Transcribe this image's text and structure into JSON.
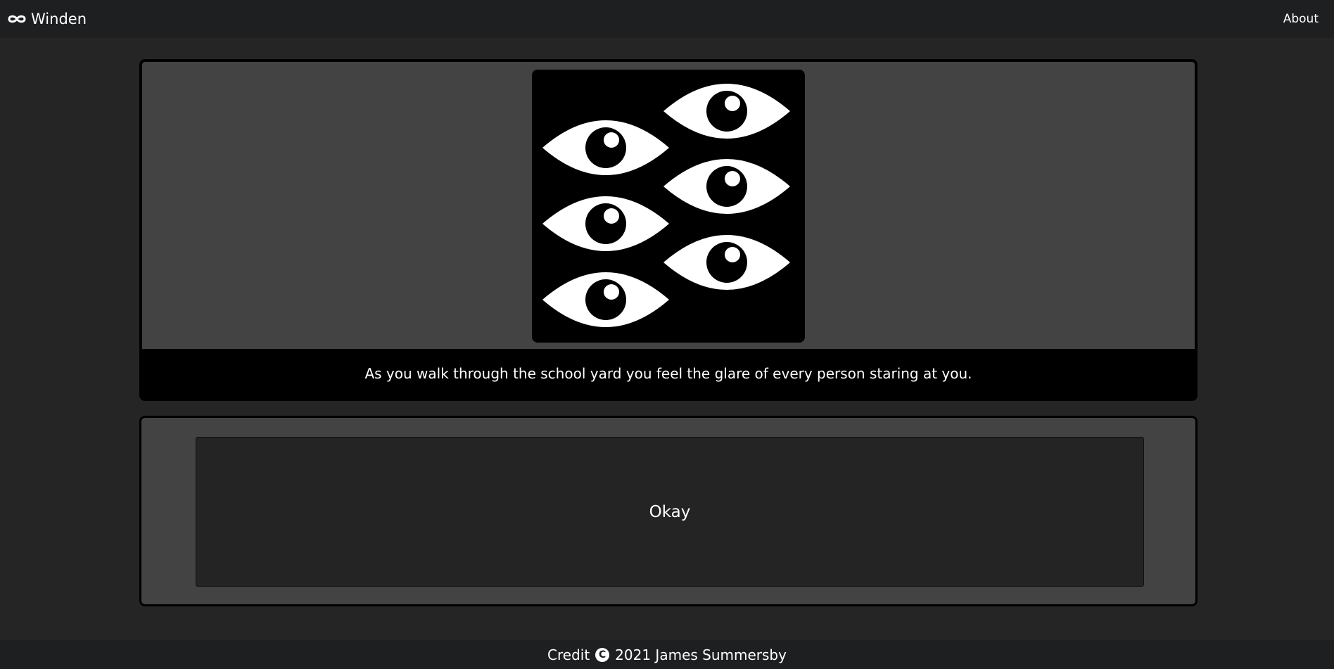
{
  "navbar": {
    "brand_name": "Winden",
    "about_label": "About"
  },
  "scene": {
    "image_icon": "six-staring-eyes-icon",
    "text": "As you walk through the school yard you feel the glare of every person staring at you."
  },
  "choices": [
    {
      "label": "Okay"
    }
  ],
  "footer": {
    "credit_prefix": "Credit",
    "copyright_icon": "copyright-icon",
    "credit_text": "2021 James Summersby"
  },
  "colors": {
    "page_background": "#252525",
    "navbar_background": "#1e1f21",
    "card_background": "#434343",
    "button_background": "#242424",
    "text": "#ffffff"
  }
}
